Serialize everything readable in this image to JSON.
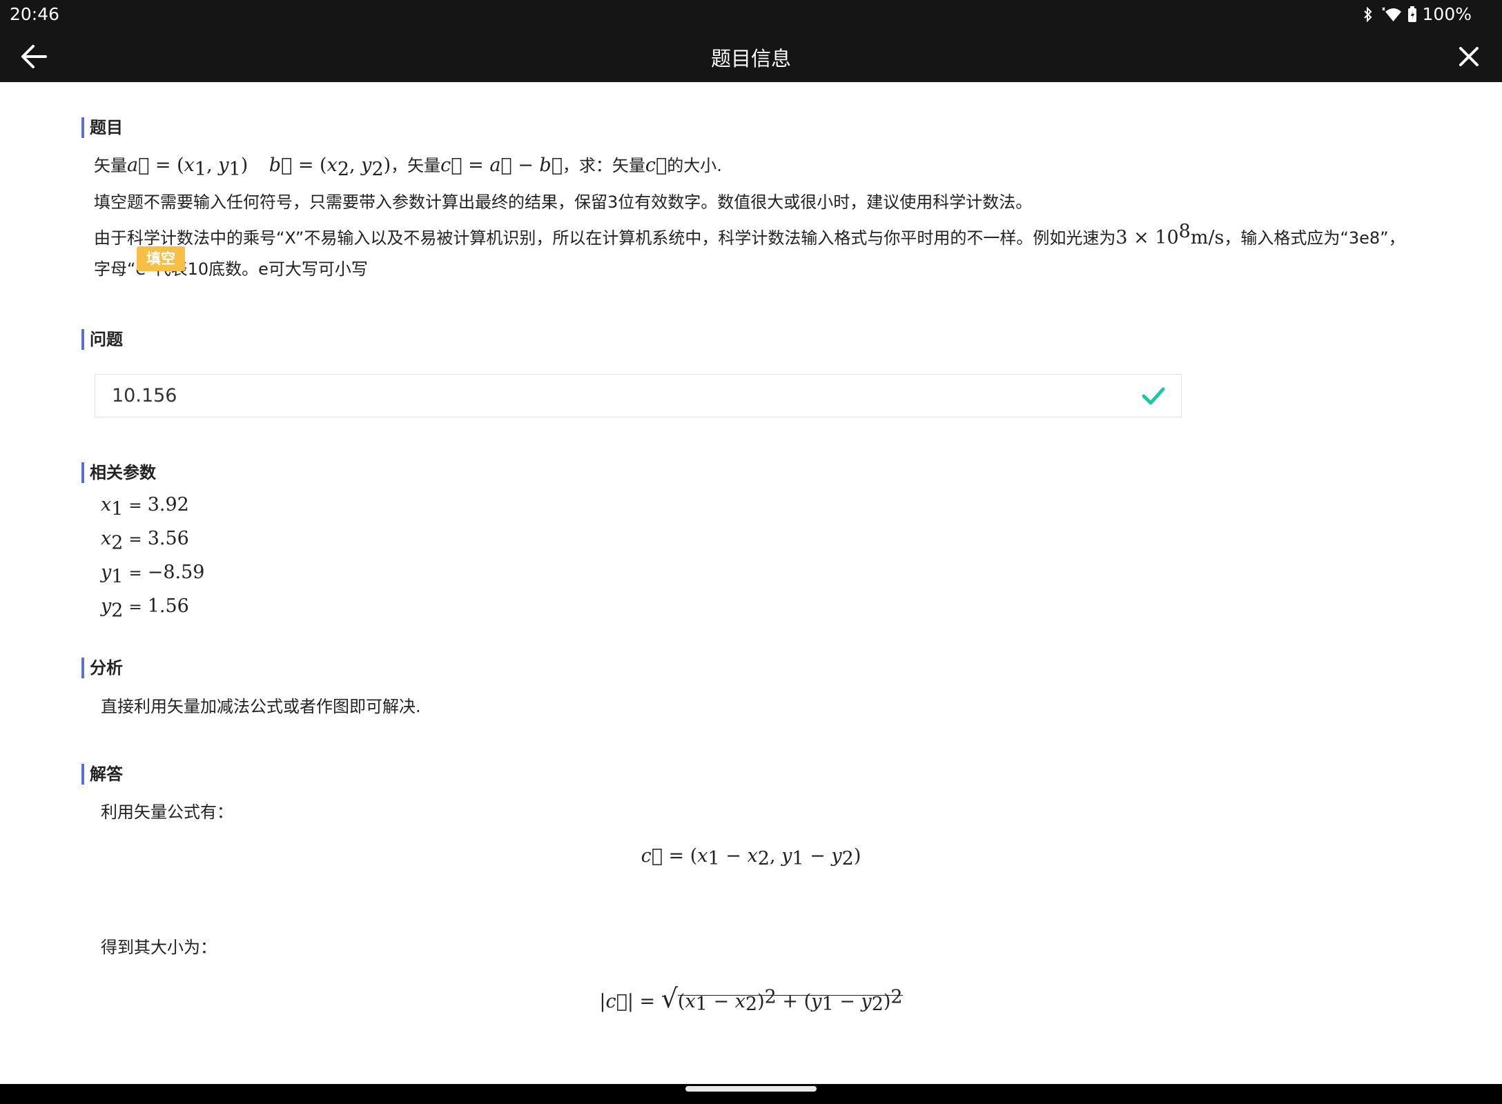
{
  "status": {
    "time": "20:46",
    "battery": "100%",
    "icons": [
      "bluetooth-icon",
      "wifi-icon",
      "battery-icon"
    ]
  },
  "appbar": {
    "title": "题目信息",
    "back_icon": "arrow-left-icon",
    "close_icon": "close-icon"
  },
  "sections": {
    "question_title": "题目",
    "problem_title": "问题",
    "problem_badge": "填空",
    "params_title": "相关参数",
    "analysis_title": "分析",
    "solution_title": "解答"
  },
  "question": {
    "line1_prefix": "矢量",
    "line1_sep": "，矢量",
    "line1_suffix": "，求：矢量",
    "line1_end": "的大小.",
    "line2": "填空题不需要输入任何符号，只需要带入参数计算出最终的结果，保留3位有效数字。数值很大或很小时，建议使用科学计数法。",
    "line3_prefix": "由于科学计数法中的乘号“X”不易输入以及不易被计算机识别，所以在计算机系统中，科学计数法输入格式与你平时用的不一样。例如光速为",
    "line3_suffix": "，输入格式应为“3e8”，",
    "line4": "字母“e”代表10底数。e可大写可小写"
  },
  "answer": {
    "value": "10.156",
    "status_icon": "check-icon"
  },
  "params": [
    {
      "var": "x",
      "sub": "1",
      "value": "3.92"
    },
    {
      "var": "x",
      "sub": "2",
      "value": "3.56"
    },
    {
      "var": "y",
      "sub": "1",
      "value": "−8.59"
    },
    {
      "var": "y",
      "sub": "2",
      "value": "1.56"
    }
  ],
  "analysis": {
    "text": "直接利用矢量加减法公式或者作图即可解决."
  },
  "solution": {
    "step1": "利用矢量公式有：",
    "step2": "得到其大小为："
  },
  "colors": {
    "accent_bar": "#5b6fd6",
    "badge": "#f8bf45",
    "check": "#1fc6a5",
    "appbar": "#151515"
  }
}
